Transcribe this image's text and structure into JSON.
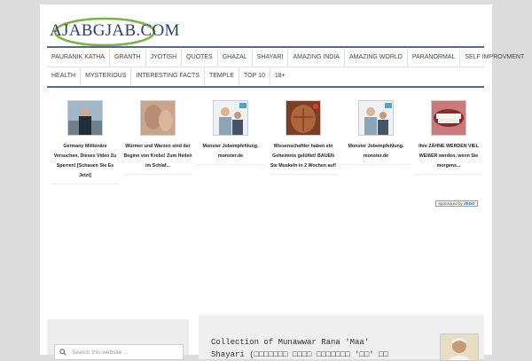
{
  "site": {
    "logo_text": "AJABGJAB.COM"
  },
  "nav": {
    "row1": [
      "PAURANIK KATHA",
      "GRANTH",
      "JYOTISH",
      "QUOTES",
      "GHAZAL",
      "SHAYARI",
      "AMAZING INDIA",
      "AMAZING WORLD",
      "PARANORMAL",
      "SELF IMPROVMENT"
    ],
    "row2": [
      "HEALTH",
      "MYSTERIOUS",
      "INTERESTING FACTS",
      "TEMPLE",
      "TOP 10",
      "18+"
    ]
  },
  "ads": [
    {
      "text": "Germany Millionäre Versuchen, Dieses Video Zu Sperren! [Schauen Sie Es Jetzt]",
      "thumb": "man-car"
    },
    {
      "text": "Würmer und Warzen sind der Beginn von Krebs! Zum Heilen im Schlaf...",
      "thumb": "skin"
    },
    {
      "text": "Monster Jobempfehlung. monster.de",
      "thumb": "people"
    },
    {
      "text": "Wissenschaftler haben ein Geheimnis gelüftet! BAUEN Sie Muskeln in 2 Wochen auf!",
      "thumb": "muscle"
    },
    {
      "text": "Monster Jobempfehlung. monster.de",
      "thumb": "people"
    },
    {
      "text": "Ihre ZÄHNE WERDEN VIEL WEIßER werden, wenn Sie morgens...",
      "thumb": "teeth"
    }
  ],
  "sponsored_label": "Sponsored by",
  "sponsored_brand": "ZEDO",
  "search": {
    "placeholder": "Search this website ..."
  },
  "post": {
    "title": "Collection of Munawwar Rana 'Maa' Shayari (□□□□□□□ □□□□ □□□□□□□ '□□' □□"
  },
  "colors": {
    "nav_rule": "#4f6a96",
    "logo": "#2c3e78",
    "background": "#dcdcdc"
  }
}
